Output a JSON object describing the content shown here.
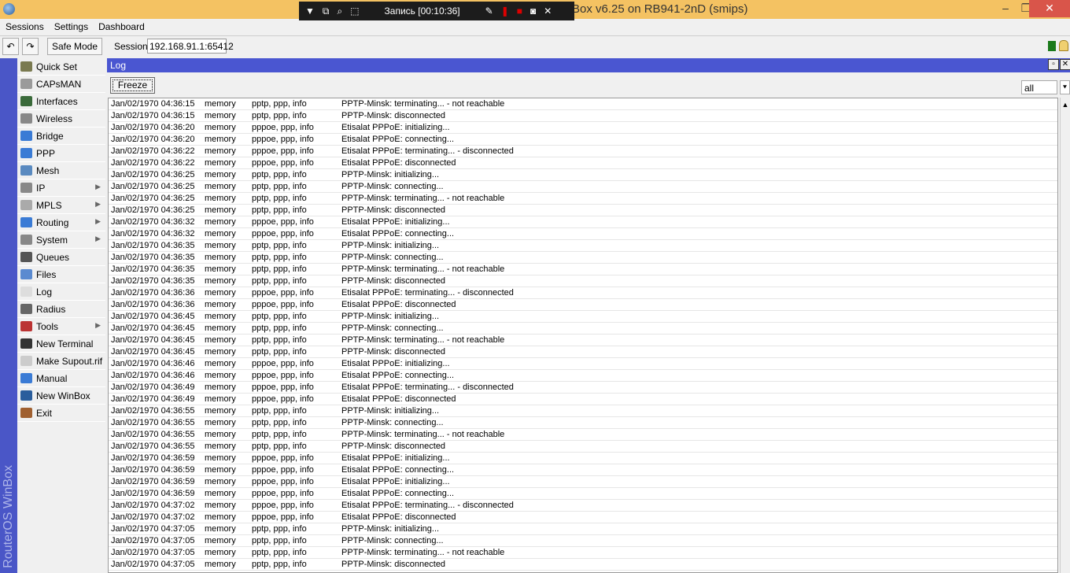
{
  "window": {
    "title": "Box v6.25 on RB941-2nD (smips)",
    "minimize": "–",
    "maximize": "❐",
    "close": "✕"
  },
  "recorder": {
    "label": "Запись [00:10:36]"
  },
  "menu": [
    "Sessions",
    "Settings",
    "Dashboard"
  ],
  "toolbar": {
    "undo": "↶",
    "redo": "↷",
    "safe_mode": "Safe Mode",
    "session_label": "Session:",
    "session_value": "192.168.91.1:65412"
  },
  "brand": "RouterOS WinBox",
  "sidebar": [
    {
      "label": "Quick Set",
      "color": "#7a7a50",
      "sub": false
    },
    {
      "label": "CAPsMAN",
      "color": "#9a9a9a",
      "sub": false
    },
    {
      "label": "Interfaces",
      "color": "#3a6a3a",
      "sub": false
    },
    {
      "label": "Wireless",
      "color": "#888",
      "sub": false
    },
    {
      "label": "Bridge",
      "color": "#3a7bd5",
      "sub": false
    },
    {
      "label": "PPP",
      "color": "#3a7bd5",
      "sub": false
    },
    {
      "label": "Mesh",
      "color": "#5a8ac0",
      "sub": false
    },
    {
      "label": "IP",
      "color": "#888",
      "sub": true
    },
    {
      "label": "MPLS",
      "color": "#aaa",
      "sub": true
    },
    {
      "label": "Routing",
      "color": "#3a7bd5",
      "sub": true
    },
    {
      "label": "System",
      "color": "#888",
      "sub": true
    },
    {
      "label": "Queues",
      "color": "#555",
      "sub": false
    },
    {
      "label": "Files",
      "color": "#5a8ad0",
      "sub": false
    },
    {
      "label": "Log",
      "color": "#ddd",
      "sub": false
    },
    {
      "label": "Radius",
      "color": "#666",
      "sub": false
    },
    {
      "label": "Tools",
      "color": "#b33",
      "sub": true
    },
    {
      "label": "New Terminal",
      "color": "#333",
      "sub": false
    },
    {
      "label": "Make Supout.rif",
      "color": "#ccc",
      "sub": false
    },
    {
      "label": "Manual",
      "color": "#3a7bd5",
      "sub": false
    },
    {
      "label": "New WinBox",
      "color": "#2a5d9c",
      "sub": false
    },
    {
      "label": "Exit",
      "color": "#a06030",
      "sub": false
    }
  ],
  "log": {
    "title": "Log",
    "freeze": "Freeze",
    "filter": "all",
    "buffer": "memory",
    "date": "Jan/02/1970",
    "rows": [
      [
        "04:36:15",
        "pptp, ppp, info",
        "PPTP-Minsk: terminating... - not reachable"
      ],
      [
        "04:36:15",
        "pptp, ppp, info",
        "PPTP-Minsk: disconnected"
      ],
      [
        "04:36:20",
        "pppoe, ppp, info",
        "Etisalat PPPoE: initializing..."
      ],
      [
        "04:36:20",
        "pppoe, ppp, info",
        "Etisalat PPPoE: connecting..."
      ],
      [
        "04:36:22",
        "pppoe, ppp, info",
        "Etisalat PPPoE: terminating... - disconnected"
      ],
      [
        "04:36:22",
        "pppoe, ppp, info",
        "Etisalat PPPoE: disconnected"
      ],
      [
        "04:36:25",
        "pptp, ppp, info",
        "PPTP-Minsk: initializing..."
      ],
      [
        "04:36:25",
        "pptp, ppp, info",
        "PPTP-Minsk: connecting..."
      ],
      [
        "04:36:25",
        "pptp, ppp, info",
        "PPTP-Minsk: terminating... - not reachable"
      ],
      [
        "04:36:25",
        "pptp, ppp, info",
        "PPTP-Minsk: disconnected"
      ],
      [
        "04:36:32",
        "pppoe, ppp, info",
        "Etisalat PPPoE: initializing..."
      ],
      [
        "04:36:32",
        "pppoe, ppp, info",
        "Etisalat PPPoE: connecting..."
      ],
      [
        "04:36:35",
        "pptp, ppp, info",
        "PPTP-Minsk: initializing..."
      ],
      [
        "04:36:35",
        "pptp, ppp, info",
        "PPTP-Minsk: connecting..."
      ],
      [
        "04:36:35",
        "pptp, ppp, info",
        "PPTP-Minsk: terminating... - not reachable"
      ],
      [
        "04:36:35",
        "pptp, ppp, info",
        "PPTP-Minsk: disconnected"
      ],
      [
        "04:36:36",
        "pppoe, ppp, info",
        "Etisalat PPPoE: terminating... - disconnected"
      ],
      [
        "04:36:36",
        "pppoe, ppp, info",
        "Etisalat PPPoE: disconnected"
      ],
      [
        "04:36:45",
        "pptp, ppp, info",
        "PPTP-Minsk: initializing..."
      ],
      [
        "04:36:45",
        "pptp, ppp, info",
        "PPTP-Minsk: connecting..."
      ],
      [
        "04:36:45",
        "pptp, ppp, info",
        "PPTP-Minsk: terminating... - not reachable"
      ],
      [
        "04:36:45",
        "pptp, ppp, info",
        "PPTP-Minsk: disconnected"
      ],
      [
        "04:36:46",
        "pppoe, ppp, info",
        "Etisalat PPPoE: initializing..."
      ],
      [
        "04:36:46",
        "pppoe, ppp, info",
        "Etisalat PPPoE: connecting..."
      ],
      [
        "04:36:49",
        "pppoe, ppp, info",
        "Etisalat PPPoE: terminating... - disconnected"
      ],
      [
        "04:36:49",
        "pppoe, ppp, info",
        "Etisalat PPPoE: disconnected"
      ],
      [
        "04:36:55",
        "pptp, ppp, info",
        "PPTP-Minsk: initializing..."
      ],
      [
        "04:36:55",
        "pptp, ppp, info",
        "PPTP-Minsk: connecting..."
      ],
      [
        "04:36:55",
        "pptp, ppp, info",
        "PPTP-Minsk: terminating... - not reachable"
      ],
      [
        "04:36:55",
        "pptp, ppp, info",
        "PPTP-Minsk: disconnected"
      ],
      [
        "04:36:59",
        "pppoe, ppp, info",
        "Etisalat PPPoE: initializing..."
      ],
      [
        "04:36:59",
        "pppoe, ppp, info",
        "Etisalat PPPoE: connecting..."
      ],
      [
        "04:36:59",
        "pppoe, ppp, info",
        "Etisalat PPPoE: initializing..."
      ],
      [
        "04:36:59",
        "pppoe, ppp, info",
        "Etisalat PPPoE: connecting..."
      ],
      [
        "04:37:02",
        "pppoe, ppp, info",
        "Etisalat PPPoE: terminating... - disconnected"
      ],
      [
        "04:37:02",
        "pppoe, ppp, info",
        "Etisalat PPPoE: disconnected"
      ],
      [
        "04:37:05",
        "pptp, ppp, info",
        "PPTP-Minsk: initializing..."
      ],
      [
        "04:37:05",
        "pptp, ppp, info",
        "PPTP-Minsk: connecting..."
      ],
      [
        "04:37:05",
        "pptp, ppp, info",
        "PPTP-Minsk: terminating... - not reachable"
      ],
      [
        "04:37:05",
        "pptp, ppp, info",
        "PPTP-Minsk: disconnected"
      ]
    ]
  }
}
